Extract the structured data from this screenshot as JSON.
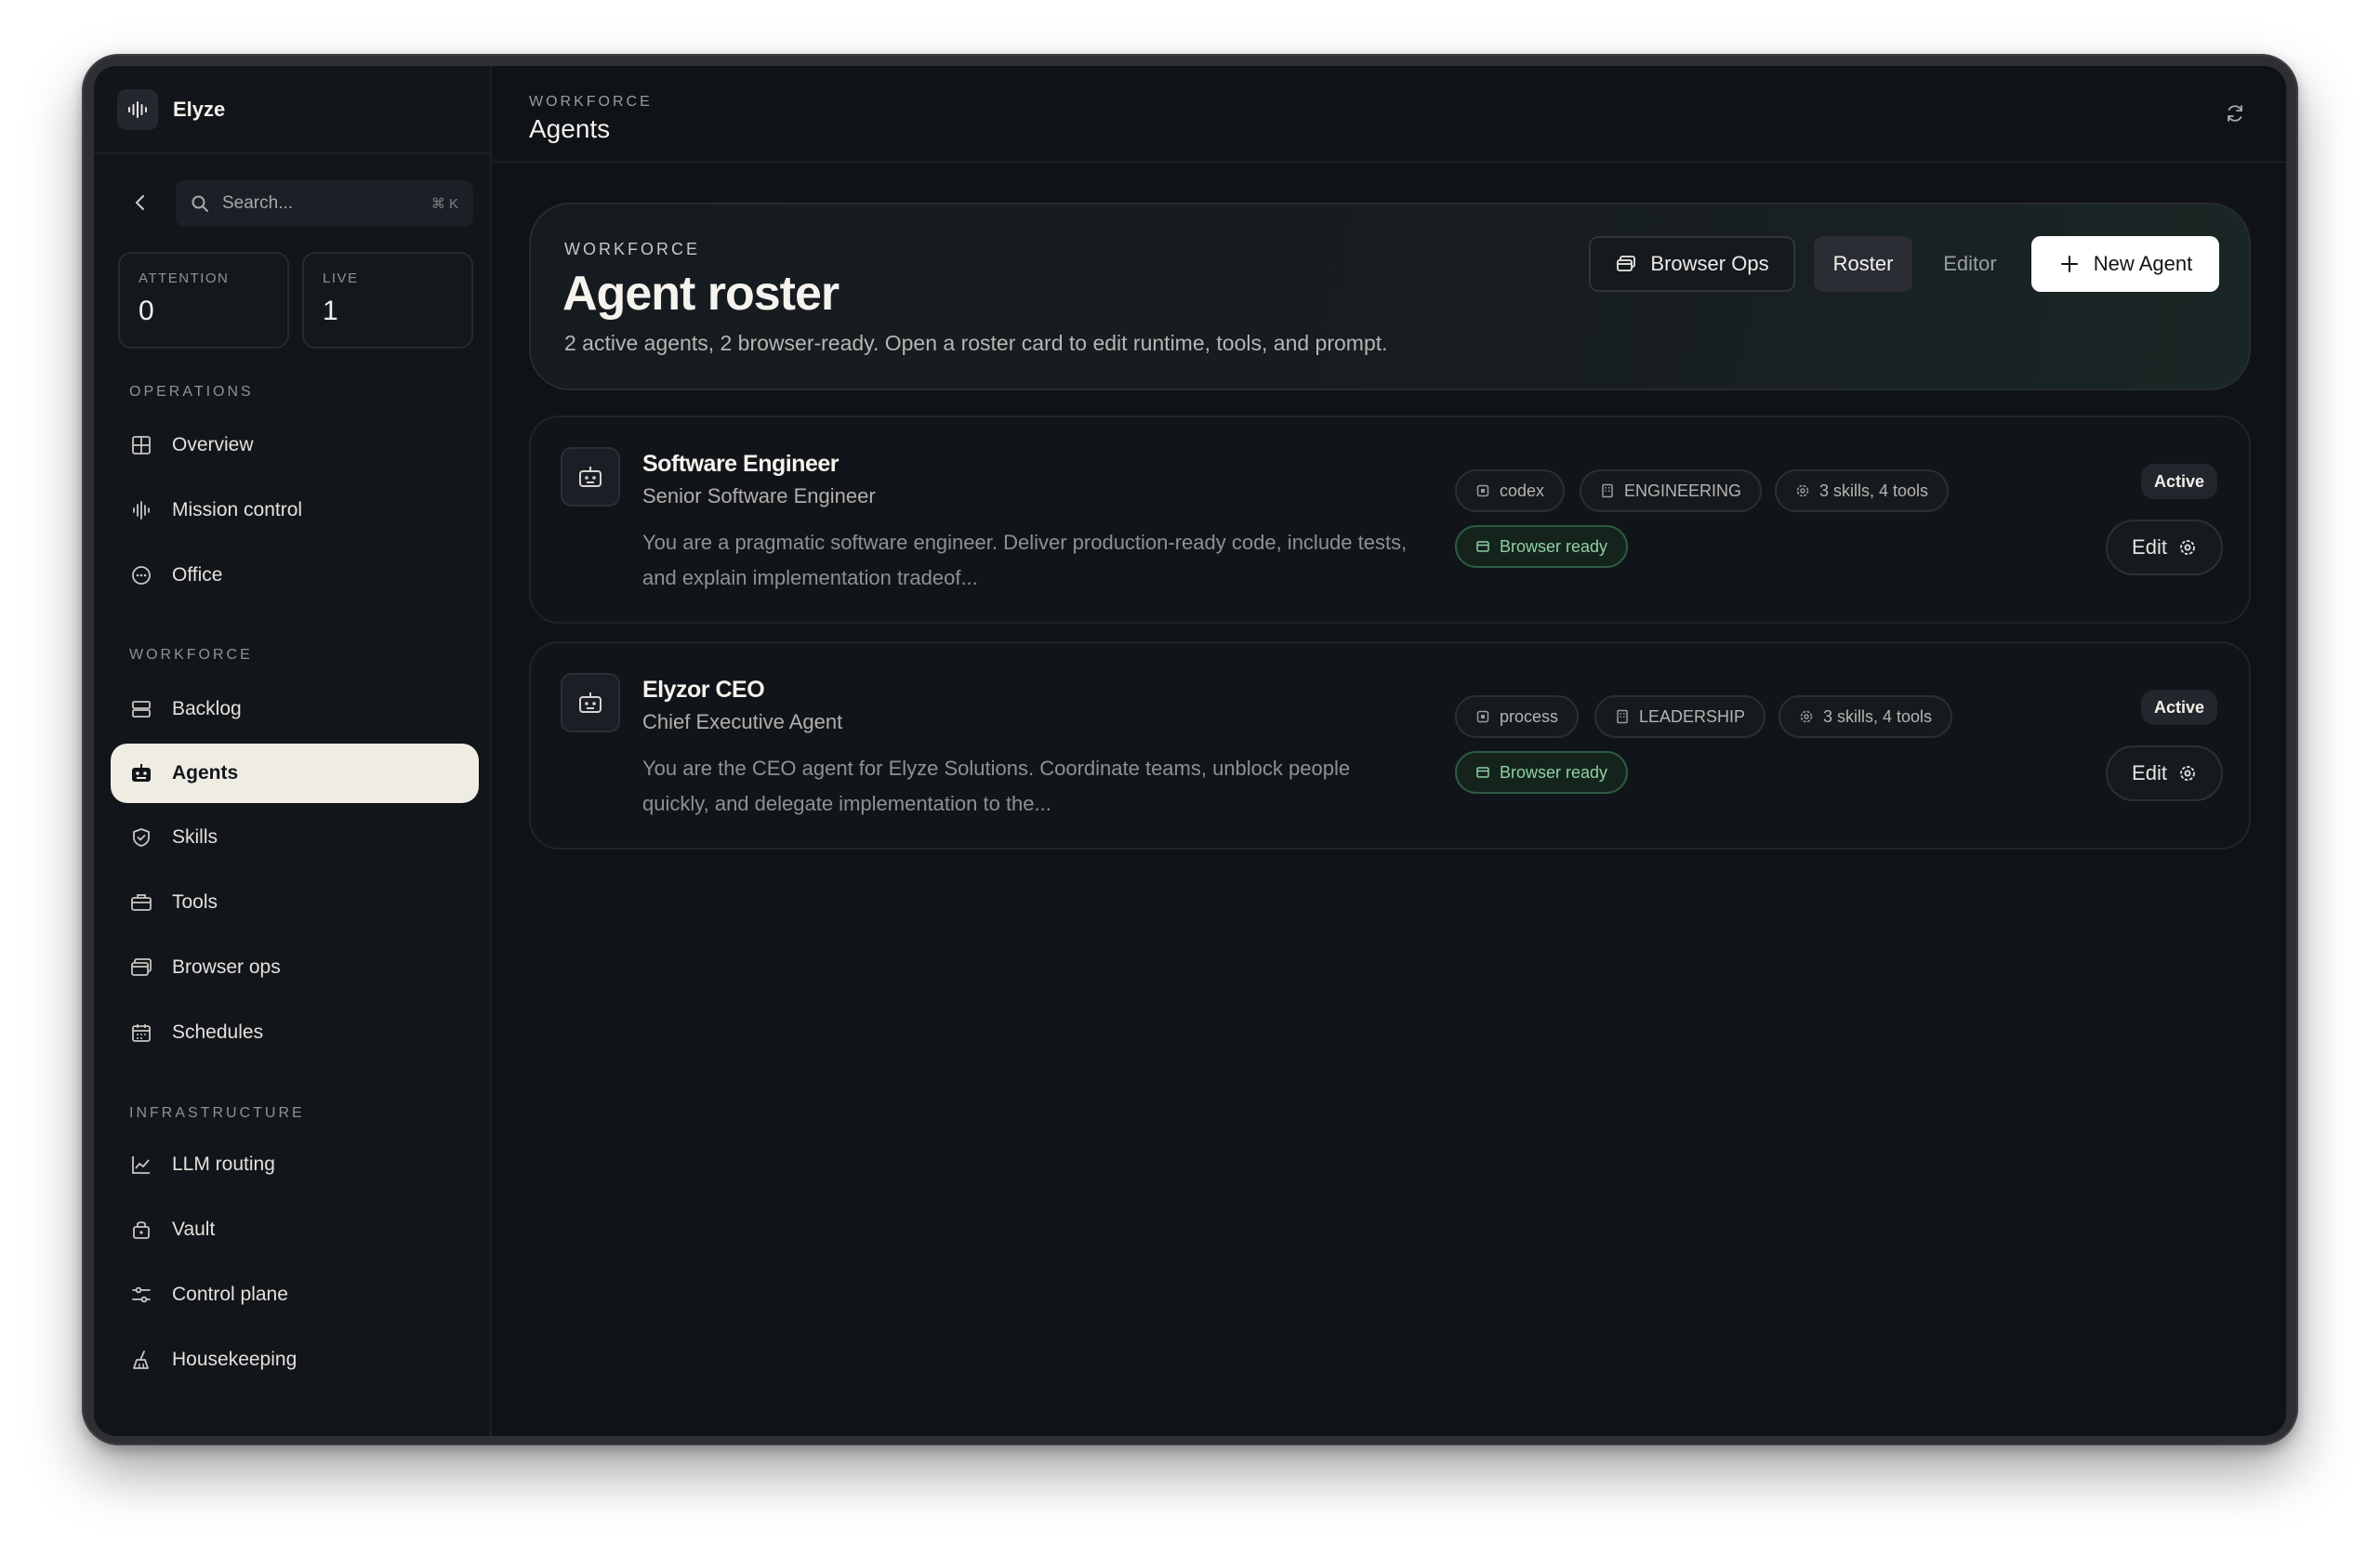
{
  "app": {
    "name": "Elyze"
  },
  "search": {
    "placeholder": "Search...",
    "shortcut": "⌘ K"
  },
  "stats": [
    {
      "label": "ATTENTION",
      "value": "0"
    },
    {
      "label": "LIVE",
      "value": "1"
    }
  ],
  "sidebar": {
    "sections": [
      {
        "title": "OPERATIONS",
        "items": [
          {
            "label": "Overview",
            "icon": "grid-icon"
          },
          {
            "label": "Mission control",
            "icon": "waveform-icon"
          },
          {
            "label": "Office",
            "icon": "dots-circle-icon"
          }
        ]
      },
      {
        "title": "WORKFORCE",
        "items": [
          {
            "label": "Backlog",
            "icon": "stack-icon"
          },
          {
            "label": "Agents",
            "icon": "robot-icon",
            "active": true
          },
          {
            "label": "Skills",
            "icon": "shield-check-icon"
          },
          {
            "label": "Tools",
            "icon": "briefcase-icon"
          },
          {
            "label": "Browser ops",
            "icon": "browser-icon"
          },
          {
            "label": "Schedules",
            "icon": "calendar-icon"
          }
        ]
      },
      {
        "title": "INFRASTRUCTURE",
        "items": [
          {
            "label": "LLM routing",
            "icon": "chart-line-icon"
          },
          {
            "label": "Vault",
            "icon": "lock-bag-icon"
          },
          {
            "label": "Control plane",
            "icon": "sliders-icon"
          },
          {
            "label": "Housekeeping",
            "icon": "broom-icon"
          }
        ]
      }
    ]
  },
  "topbar": {
    "kicker": "WORKFORCE",
    "title": "Agents"
  },
  "hero": {
    "kicker": "WORKFORCE",
    "title": "Agent roster",
    "subtitle": "2 active agents, 2 browser-ready. Open a roster card to edit runtime, tools, and prompt.",
    "buttons": {
      "browser_ops": "Browser Ops",
      "roster": "Roster",
      "editor": "Editor",
      "new_agent": "New Agent"
    }
  },
  "agents": [
    {
      "name": "Software Engineer",
      "role": "Senior Software Engineer",
      "description_line1": "You are a pragmatic software engineer. Deliver production-ready code, include tests,",
      "description_line2": "and explain implementation tradeof...",
      "chips": [
        "codex",
        "ENGINEERING",
        "3 skills, 4 tools"
      ],
      "browser": "Browser ready",
      "status": "Active",
      "edit": "Edit"
    },
    {
      "name": "Elyzor CEO",
      "role": "Chief Executive Agent",
      "description_line1": "You are the CEO agent for Elyze Solutions. Coordinate teams, unblock people",
      "description_line2": "quickly, and delegate implementation to the...",
      "chips": [
        "process",
        "LEADERSHIP",
        "3 skills, 4 tools"
      ],
      "browser": "Browser ready",
      "status": "Active",
      "edit": "Edit"
    }
  ],
  "colors": {
    "accent_green": "#8fd0a5",
    "active_nav_bg": "#efece3",
    "background": "#0f1217"
  }
}
